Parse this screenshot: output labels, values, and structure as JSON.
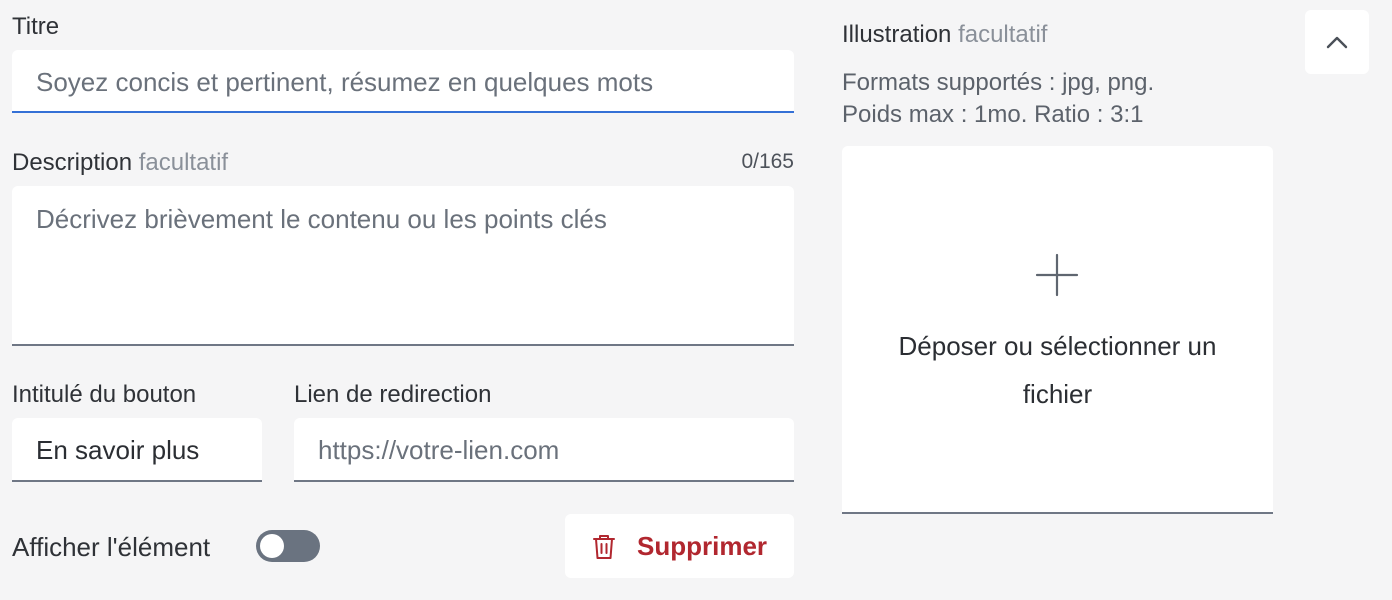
{
  "title_field": {
    "label": "Titre",
    "placeholder": "Soyez concis et pertinent, résumez en quelques mots"
  },
  "description_field": {
    "label": "Description",
    "optional_tag": "facultatif",
    "counter": "0/165",
    "placeholder": "Décrivez brièvement le contenu ou les points clés"
  },
  "button_label_field": {
    "label": "Intitulé du bouton",
    "value": "En savoir plus"
  },
  "link_field": {
    "label": "Lien de redirection",
    "placeholder": "https://votre-lien.com"
  },
  "visibility": {
    "label": "Afficher l'élément",
    "enabled": false
  },
  "delete_button": {
    "label": "Supprimer",
    "icon": "trash-icon",
    "color": "#b1272f"
  },
  "illustration": {
    "label": "Illustration",
    "optional_tag": "facultatif",
    "help_line1": "Formats supportés : jpg, png.",
    "help_line2": "Poids max : 1mo. Ratio : 3:1",
    "dropzone_icon": "plus-icon",
    "dropzone_line1": "Déposer ou sélectionner un",
    "dropzone_line2": "fichier"
  },
  "collapse_button": {
    "icon": "chevron-up-icon"
  }
}
